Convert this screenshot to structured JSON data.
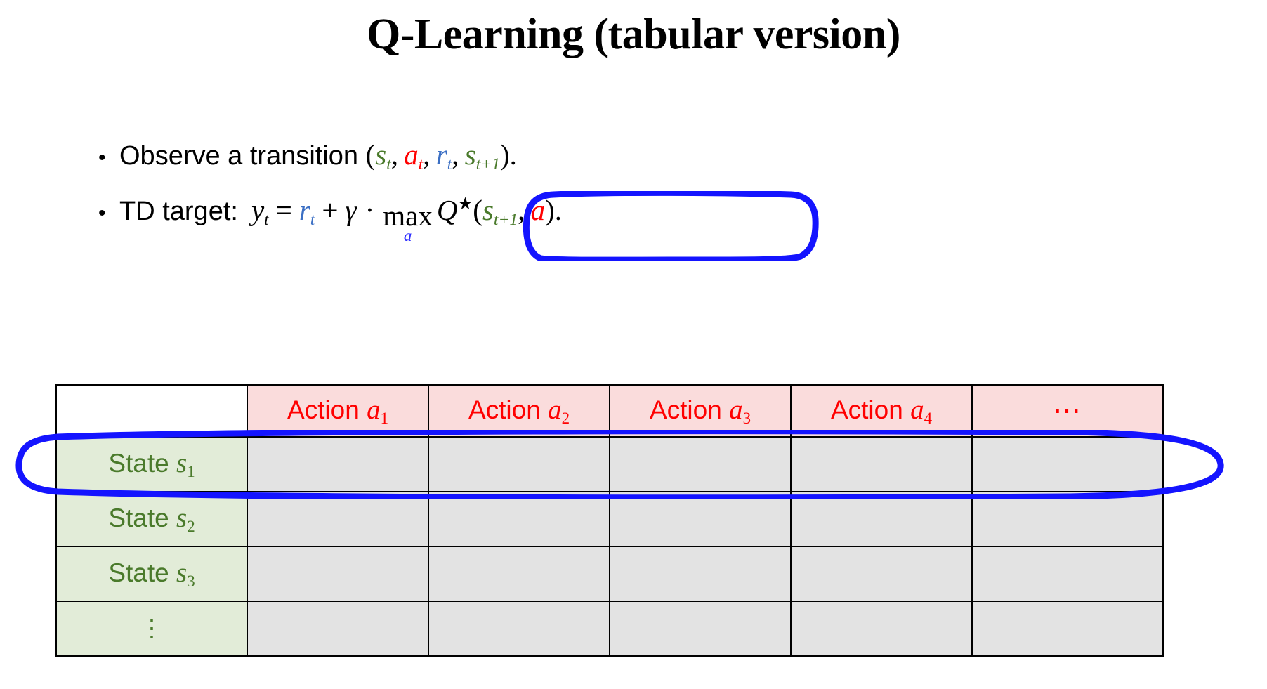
{
  "slide": {
    "title": "Q-Learning (tabular version)",
    "background_color": "#ffffff"
  },
  "colors": {
    "state_green": "#4a7a2b",
    "action_red": "#ff0000",
    "reward_blue": "#3b6fc4",
    "annotation_blue": "#1414ff",
    "header_fill": "#fadcdc",
    "state_fill": "#e2ecd8",
    "cell_fill": "#e3e3e3",
    "border": "#000000"
  },
  "bullets": [
    {
      "marker": "•",
      "label": "Observe a transition ",
      "formula_plain": "(s_t, a_t, r_t, s_{t+1}).",
      "tokens": {
        "open_paren": "(",
        "s": "s",
        "t": "t",
        "comma1": ", ",
        "a": "a",
        "comma2": ", ",
        "r": "r",
        "comma3": ", ",
        "s2": "s",
        "t_plus_1": "t+1",
        "close_paren": ")."
      }
    },
    {
      "marker": "•",
      "label": "TD target: ",
      "formula_plain": "y_t = r_t + γ · max_a Q★(s_{t+1}, a).",
      "tokens": {
        "y": "y",
        "t": "t",
        "equals": "=",
        "r": "r",
        "plus": "+",
        "gamma": "γ",
        "cdot": "·",
        "max": "max",
        "max_sub": "a",
        "Q": "Q",
        "star": "★",
        "open_paren": "(",
        "s": "s",
        "t_plus_1": "t+1",
        "comma": ", ",
        "a": "a",
        "close_paren": ")."
      }
    }
  ],
  "table": {
    "corner_label": "",
    "column_headers": [
      {
        "label": "Action ",
        "symbol": "a",
        "subscript": "1"
      },
      {
        "label": "Action ",
        "symbol": "a",
        "subscript": "2"
      },
      {
        "label": "Action ",
        "symbol": "a",
        "subscript": "3"
      },
      {
        "label": "Action ",
        "symbol": "a",
        "subscript": "4"
      },
      {
        "label": "⋯",
        "symbol": "",
        "subscript": ""
      }
    ],
    "row_headers": [
      {
        "label": "State ",
        "symbol": "s",
        "subscript": "1"
      },
      {
        "label": "State ",
        "symbol": "s",
        "subscript": "2"
      },
      {
        "label": "State ",
        "symbol": "s",
        "subscript": "3"
      },
      {
        "label": "⋮",
        "symbol": "",
        "subscript": ""
      }
    ],
    "cells": [
      [
        "",
        "",
        "",
        "",
        ""
      ],
      [
        "",
        "",
        "",
        "",
        ""
      ],
      [
        "",
        "",
        "",
        "",
        ""
      ],
      [
        "",
        "",
        "",
        "",
        ""
      ]
    ]
  },
  "annotations": [
    {
      "name": "ellipse-around-max-q-term",
      "color": "#1414ff",
      "shape": "rounded-rectangle-ellipse"
    },
    {
      "name": "ellipse-around-state-s2-row",
      "color": "#1414ff",
      "shape": "ellipse"
    }
  ]
}
